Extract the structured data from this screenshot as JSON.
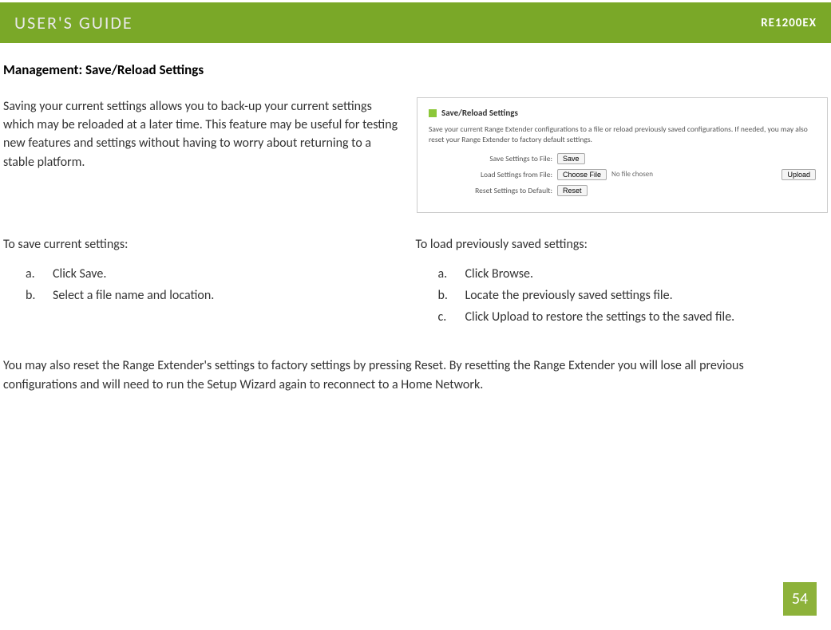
{
  "header": {
    "title": "USER'S GUIDE",
    "model": "RE1200EX"
  },
  "section_title": "Management: Save/Reload Settings",
  "intro_text": "Saving your current settings allows you to back-up your current settings which may be reloaded at a later time. This feature may be useful for testing new features and settings without having to worry about returning to a stable platform.",
  "panel": {
    "title": "Save/Reload Settings",
    "description": "Save your current Range Extender configurations to a file or reload previously saved configurations. If needed, you may also reset your Range Extender to factory default settings.",
    "fields": {
      "save_label": "Save Settings to File:",
      "save_button": "Save",
      "load_label": "Load Settings from File:",
      "choose_file_button": "Choose File",
      "no_file_text": "No file chosen",
      "upload_button": "Upload",
      "reset_label": "Reset Settings to Default:",
      "reset_button": "Reset"
    }
  },
  "save_section": {
    "title": "To save current settings:",
    "steps": [
      {
        "marker": "a.",
        "text": "Click Save."
      },
      {
        "marker": "b.",
        "text": "Select a file name and location."
      }
    ]
  },
  "load_section": {
    "title": "To load previously saved settings:",
    "steps": [
      {
        "marker": "a.",
        "text": "Click Browse."
      },
      {
        "marker": "b.",
        "text": "Locate the previously saved settings file."
      },
      {
        "marker": "c.",
        "text": "Click Upload to restore the settings to the saved file."
      }
    ]
  },
  "footer_text": "You may also reset the Range Extender's settings to factory settings by pressing Reset. By resetting the Range Extender you will lose all previous configurations and will need to run the Setup Wizard again to reconnect to a Home Network.",
  "page_number": "54"
}
